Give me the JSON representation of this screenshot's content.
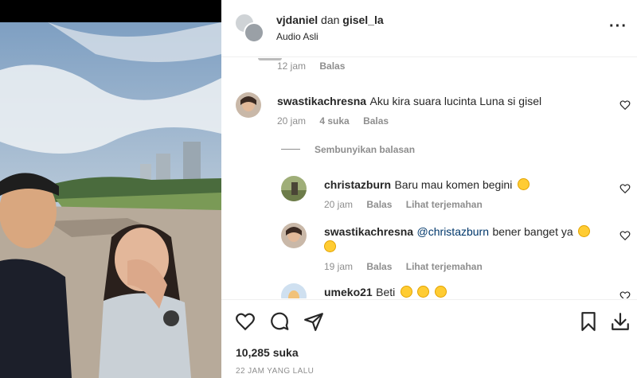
{
  "post": {
    "owner1": "vjdaniel",
    "conjunction": "dan",
    "owner2": "gisel_la",
    "audio": "Audio Asli",
    "more_icon": "more-horizontal-icon"
  },
  "comments": {
    "prev_meta": {
      "time": "12 jam",
      "reply": "Balas"
    },
    "c1": {
      "user": "swastikachresna",
      "text": "Aku kira suara lucinta Luna si gisel",
      "time": "20 jam",
      "likes": "4 suka",
      "reply": "Balas"
    },
    "hide_replies": "Sembunyikan balasan",
    "r1": {
      "user": "christazburn",
      "text": "Baru mau komen begini",
      "time": "20 jam",
      "reply": "Balas",
      "translate": "Lihat terjemahan"
    },
    "r2": {
      "user": "swastikachresna",
      "mention": "@christazburn",
      "text": "bener banget ya",
      "time": "19 jam",
      "reply": "Balas",
      "translate": "Lihat terjemahan"
    },
    "r3": {
      "user": "umeko21",
      "text": "Beti"
    }
  },
  "footer": {
    "likes": "10,285 suka",
    "posted": "22 JAM YANG LALU"
  },
  "colors": {
    "text": "#262626",
    "muted": "#8e8e8e",
    "mention": "#00376b",
    "border": "#efefef"
  }
}
